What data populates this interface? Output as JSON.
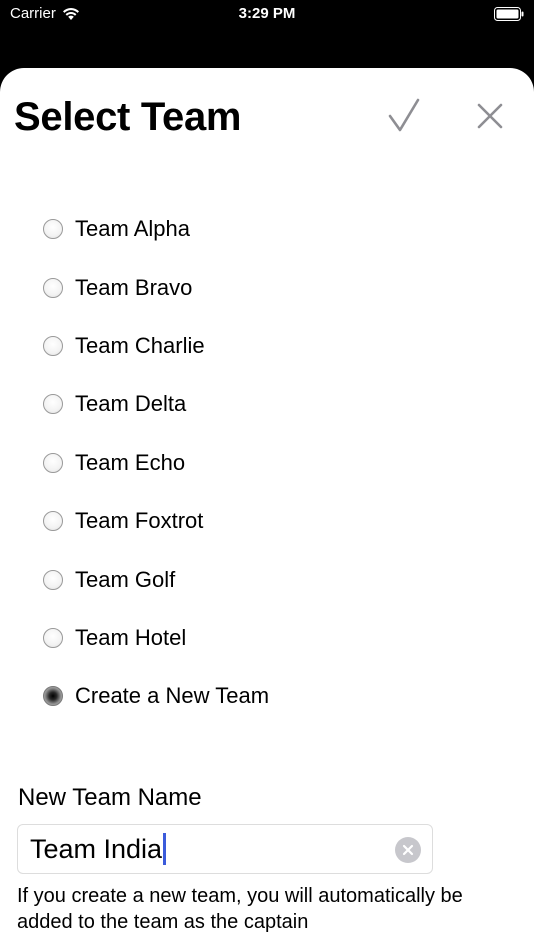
{
  "status_bar": {
    "carrier": "Carrier",
    "time": "3:29 PM"
  },
  "sheet": {
    "title": "Select Team",
    "confirm_icon": "checkmark-icon",
    "close_icon": "close-icon"
  },
  "teams": [
    {
      "label": "Team Alpha",
      "selected": false
    },
    {
      "label": "Team Bravo",
      "selected": false
    },
    {
      "label": "Team Charlie",
      "selected": false
    },
    {
      "label": "Team Delta",
      "selected": false
    },
    {
      "label": "Team Echo",
      "selected": false
    },
    {
      "label": "Team Foxtrot",
      "selected": false
    },
    {
      "label": "Team Golf",
      "selected": false
    },
    {
      "label": "Team Hotel",
      "selected": false
    },
    {
      "label": "Create a New Team",
      "selected": true
    }
  ],
  "new_team": {
    "label": "New Team Name",
    "value": "Team India",
    "clear_icon": "clear-circle-icon",
    "helper": "If you create a new team, you will automatically be added to the team as the captain"
  },
  "colors": {
    "caret": "#3b5bdb",
    "icon_gray": "#8e8e93"
  }
}
